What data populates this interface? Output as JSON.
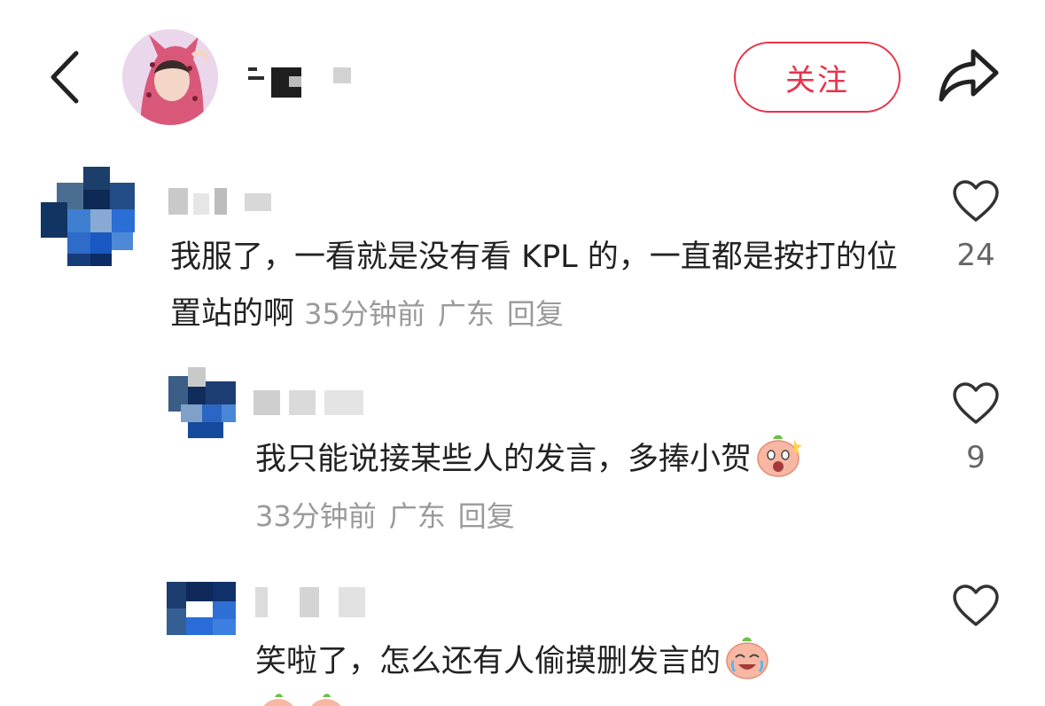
{
  "header": {
    "follow_label": "关注"
  },
  "comments": [
    {
      "text": "我服了，一看就是没有看 KPL 的，一直都是按打的位置站的啊",
      "time": "35分钟前",
      "location": "广东",
      "reply_label": "回复",
      "likes": "24"
    },
    {
      "text": "我只能说接某些人的发言，多捧小贺",
      "time": "33分钟前",
      "location": "广东",
      "reply_label": "回复",
      "likes": "9"
    },
    {
      "text": "笑啦了，怎么还有人偷摸删发言的",
      "likes": ""
    }
  ],
  "icons": {
    "back": "chevron-left-icon",
    "share": "share-arrow-icon",
    "like": "heart-outline-icon",
    "emoji": "peach-face-emoji"
  },
  "colors": {
    "accent": "#e8334a",
    "text": "#222222",
    "meta": "#9a9a9a"
  }
}
